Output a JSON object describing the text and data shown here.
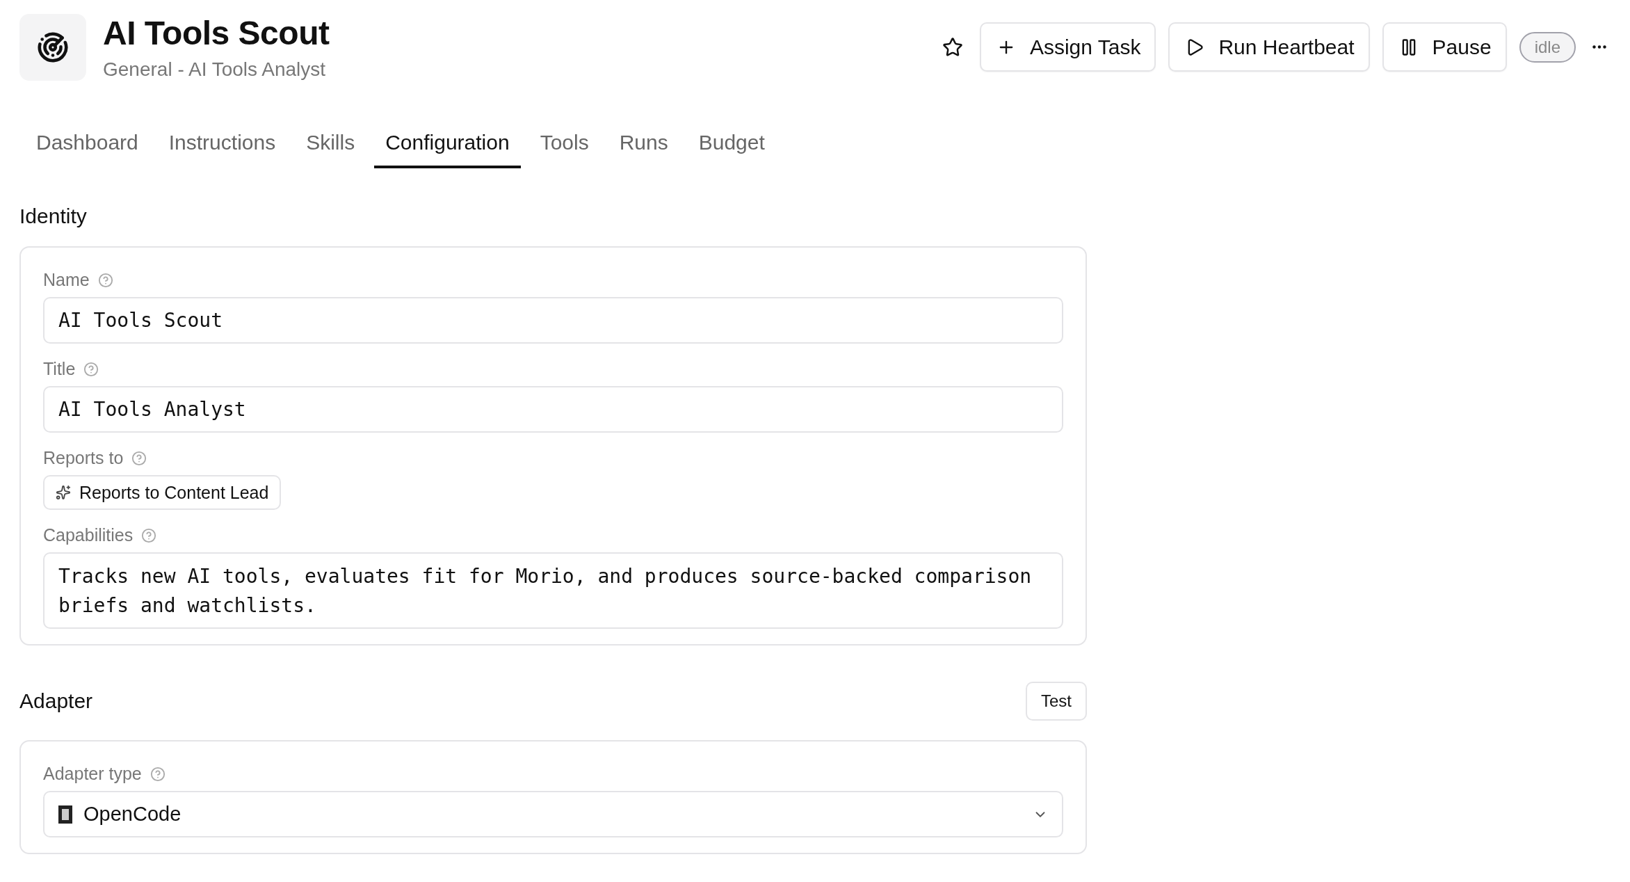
{
  "header": {
    "title": "AI Tools Scout",
    "subtitle": "General - AI Tools Analyst",
    "favorite": false
  },
  "actions": [
    {
      "kind": "assign",
      "label": "Assign Task"
    },
    {
      "kind": "run",
      "label": "Run Heartbeat"
    },
    {
      "kind": "pause",
      "label": "Pause"
    }
  ],
  "status": "idle",
  "tabs": [
    {
      "label": "Dashboard",
      "selected": false
    },
    {
      "label": "Instructions",
      "selected": false
    },
    {
      "label": "Skills",
      "selected": false
    },
    {
      "label": "Configuration",
      "selected": true
    },
    {
      "label": "Tools",
      "selected": false
    },
    {
      "label": "Runs",
      "selected": false
    },
    {
      "label": "Budget",
      "selected": false
    }
  ],
  "sections": [
    {
      "heading": "Identity",
      "fields": [
        {
          "kind": "input",
          "label": "Name",
          "value": "AI Tools Scout"
        },
        {
          "kind": "input",
          "label": "Title",
          "value": "AI Tools Analyst"
        },
        {
          "kind": "chip",
          "label": "Reports to",
          "value": "Reports to Content Lead"
        },
        {
          "kind": "textarea",
          "label": "Capabilities",
          "value": "Tracks new AI tools, evaluates fit for Morio, and produces source-backed comparison briefs and watchlists."
        }
      ]
    },
    {
      "heading": "Adapter",
      "button": "Test",
      "fields": [
        {
          "kind": "select",
          "label": "Adapter type",
          "value": "OpenCode"
        }
      ]
    }
  ]
}
